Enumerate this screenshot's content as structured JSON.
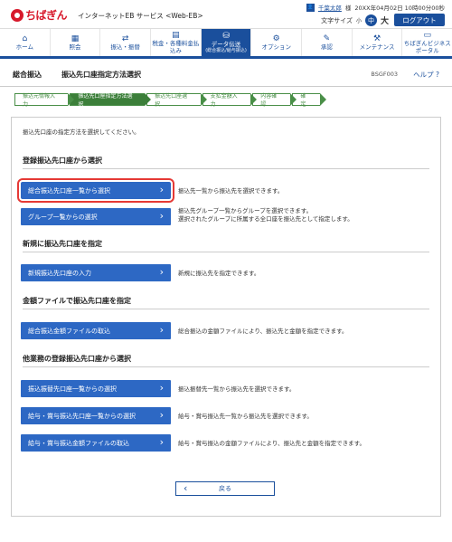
{
  "header": {
    "logo_text": "ちばぎん",
    "service_name": "インターネットEB サービス <Web-EB>",
    "user_name": "千葉太郎",
    "user_suffix": "様",
    "last_login": "20XX年04月02日 10時00分00秒",
    "font_size_label": "文字サイズ",
    "font_small": "小",
    "font_medium": "中",
    "font_large": "大",
    "logout_label": "ログアウト"
  },
  "gnav": [
    {
      "icon": "⌂",
      "label": "ホーム"
    },
    {
      "icon": "▦",
      "label": "照会"
    },
    {
      "icon": "⇄",
      "label": "振込・振替"
    },
    {
      "icon": "▤",
      "label": "税金・各種料金払込み"
    },
    {
      "icon": "⛁",
      "label": "データ伝送",
      "sub": "(総合振込/給与振込)"
    },
    {
      "icon": "⚙",
      "label": "オプション"
    },
    {
      "icon": "✎",
      "label": "承認"
    },
    {
      "icon": "⚒",
      "label": "メンテナンス"
    },
    {
      "icon": "▭",
      "label": "ちばぎんビジネスポータル"
    }
  ],
  "title_bar": {
    "category": "総合振込",
    "title": "振込先口座指定方法選択",
    "screen_id": "BSGF003",
    "help": "ヘルプ"
  },
  "steps": [
    "振込元情報入力",
    "振込先口座指定方法選択",
    "振込先口座選択",
    "支払金額入力",
    "内容確認",
    "確定"
  ],
  "lead": "振込先口座の指定方法を選択してください。",
  "sections": {
    "registered": "登録振込先口座から選択",
    "new": "新規に振込先口座を指定",
    "file": "金額ファイルで振込先口座を指定",
    "other": "他業務の登録振込先口座から選択"
  },
  "buttons": {
    "list": "総合振込先口座一覧から選択",
    "group": "グループ一覧からの選択",
    "new": "新規振込先口座の入力",
    "file": "総合振込金額ファイルの取込",
    "transfer": "振込振替先口座一覧からの選択",
    "salary_list": "給与・賞与振込先口座一覧からの選択",
    "salary_file": "給与・賞与振込金額ファイルの取込"
  },
  "descriptions": {
    "list": "振込先一覧から振込先を選択できます。",
    "group_1": "振込先グループ一覧からグループを選択できます。",
    "group_2": "選択されたグループに所属する全口座を振込先として指定します。",
    "new": "新規に振込先を指定できます。",
    "file": "総合振込の金額ファイルにより、振込先と金額を指定できます。",
    "transfer": "振込振替先一覧から振込先を選択できます。",
    "salary_list": "給与・賞与振込先一覧から振込先を選択できます。",
    "salary_file": "給与・賞与振込の金額ファイルにより、振込先と金額を指定できます。"
  },
  "back_label": "戻る",
  "colors": {
    "primary": "#1a4f9c",
    "button": "#2d68c4",
    "step": "#3c7f3a",
    "brand": "#d7192b",
    "highlight": "#e53935"
  }
}
